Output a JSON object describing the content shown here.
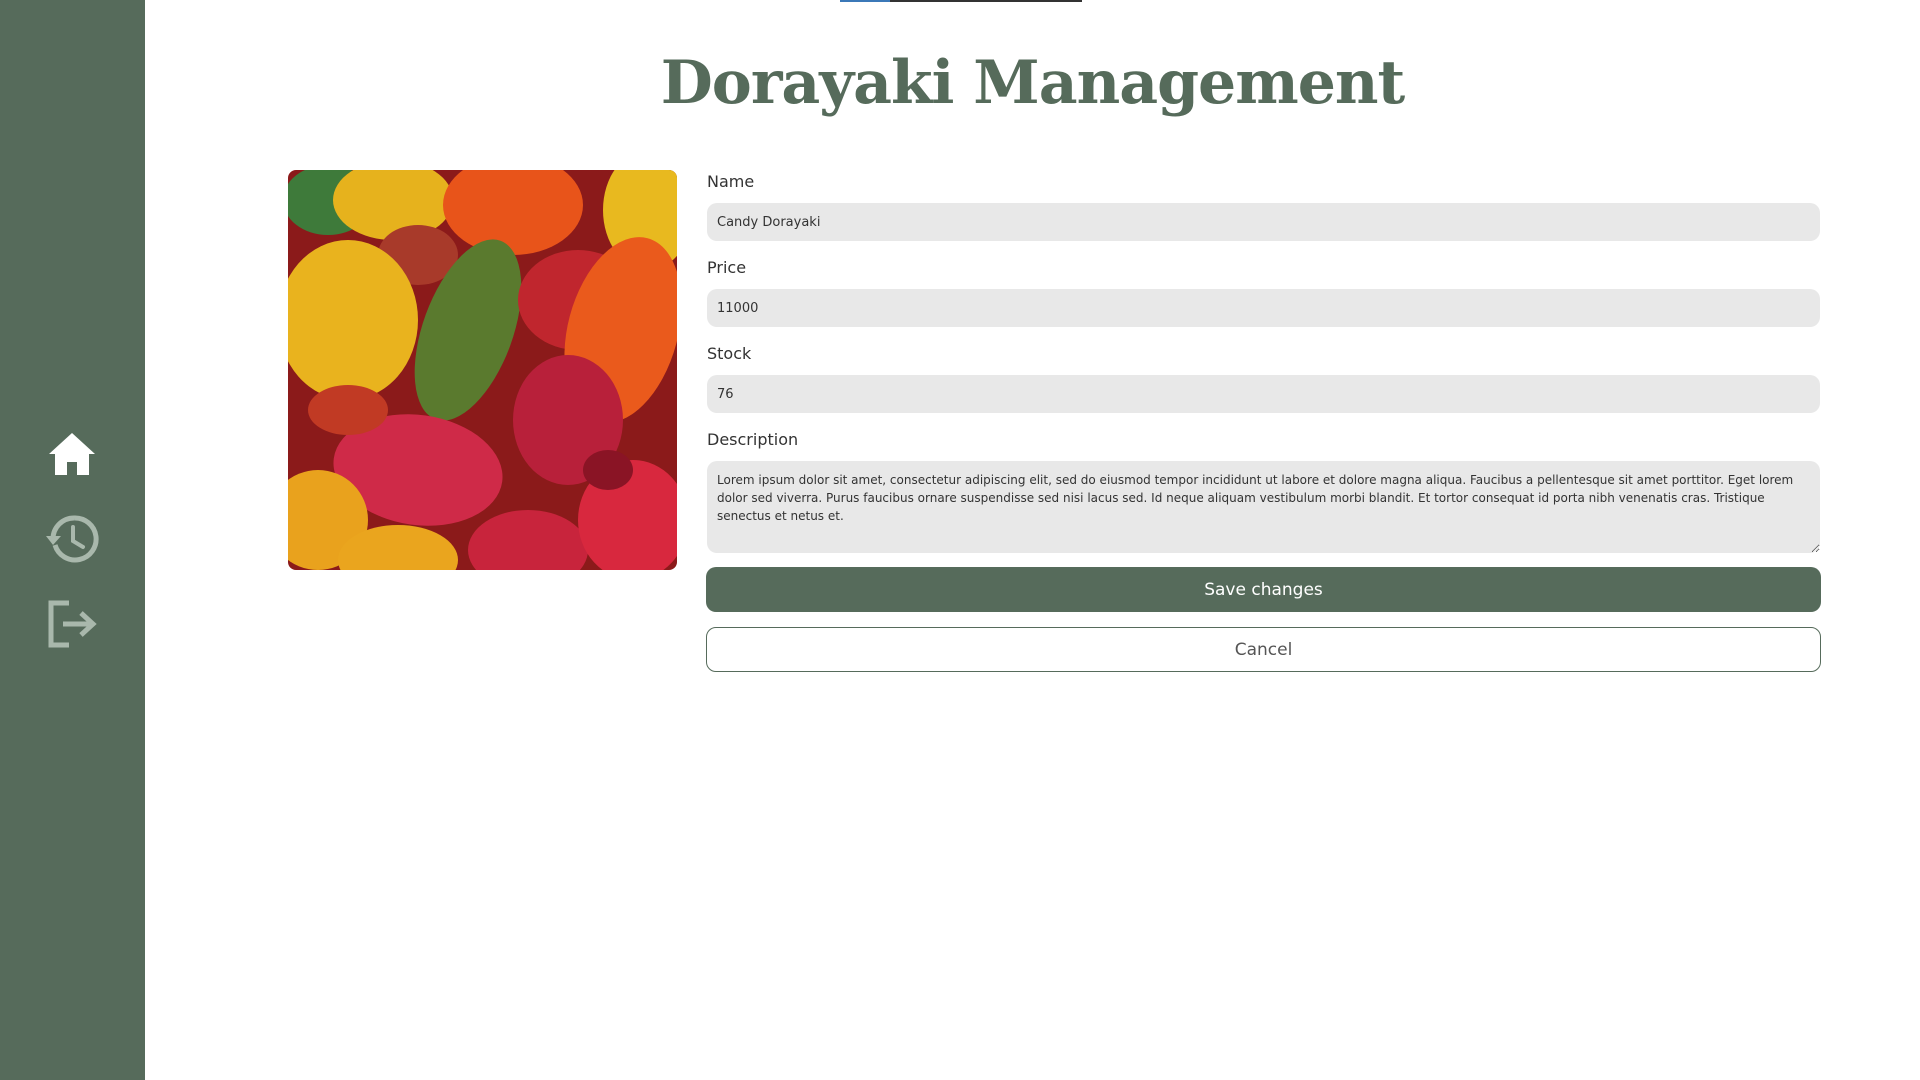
{
  "app": {
    "title": "Dorayaki Management",
    "accent_color": "#566b5b"
  },
  "sidebar": {
    "items": [
      {
        "name": "home",
        "icon": "home-icon"
      },
      {
        "name": "history",
        "icon": "history-icon"
      },
      {
        "name": "logout",
        "icon": "logout-icon"
      }
    ]
  },
  "product": {
    "image": "candy-image"
  },
  "form": {
    "name_label": "Name",
    "name_value": "Candy Dorayaki",
    "price_label": "Price",
    "price_value": "11000",
    "stock_label": "Stock",
    "stock_value": "76",
    "description_label": "Description",
    "description_value": "Lorem ipsum dolor sit amet, consectetur adipiscing elit, sed do eiusmod tempor incididunt ut labore et dolore magna aliqua. Faucibus a pellentesque sit amet porttitor. Eget lorem dolor sed viverra. Purus faucibus ornare suspendisse sed nisi lacus sed. Id neque aliquam vestibulum morbi blandit. Et tortor consequat id porta nibh venenatis cras. Tristique senectus et netus et.",
    "save_label": "Save changes",
    "cancel_label": "Cancel"
  }
}
